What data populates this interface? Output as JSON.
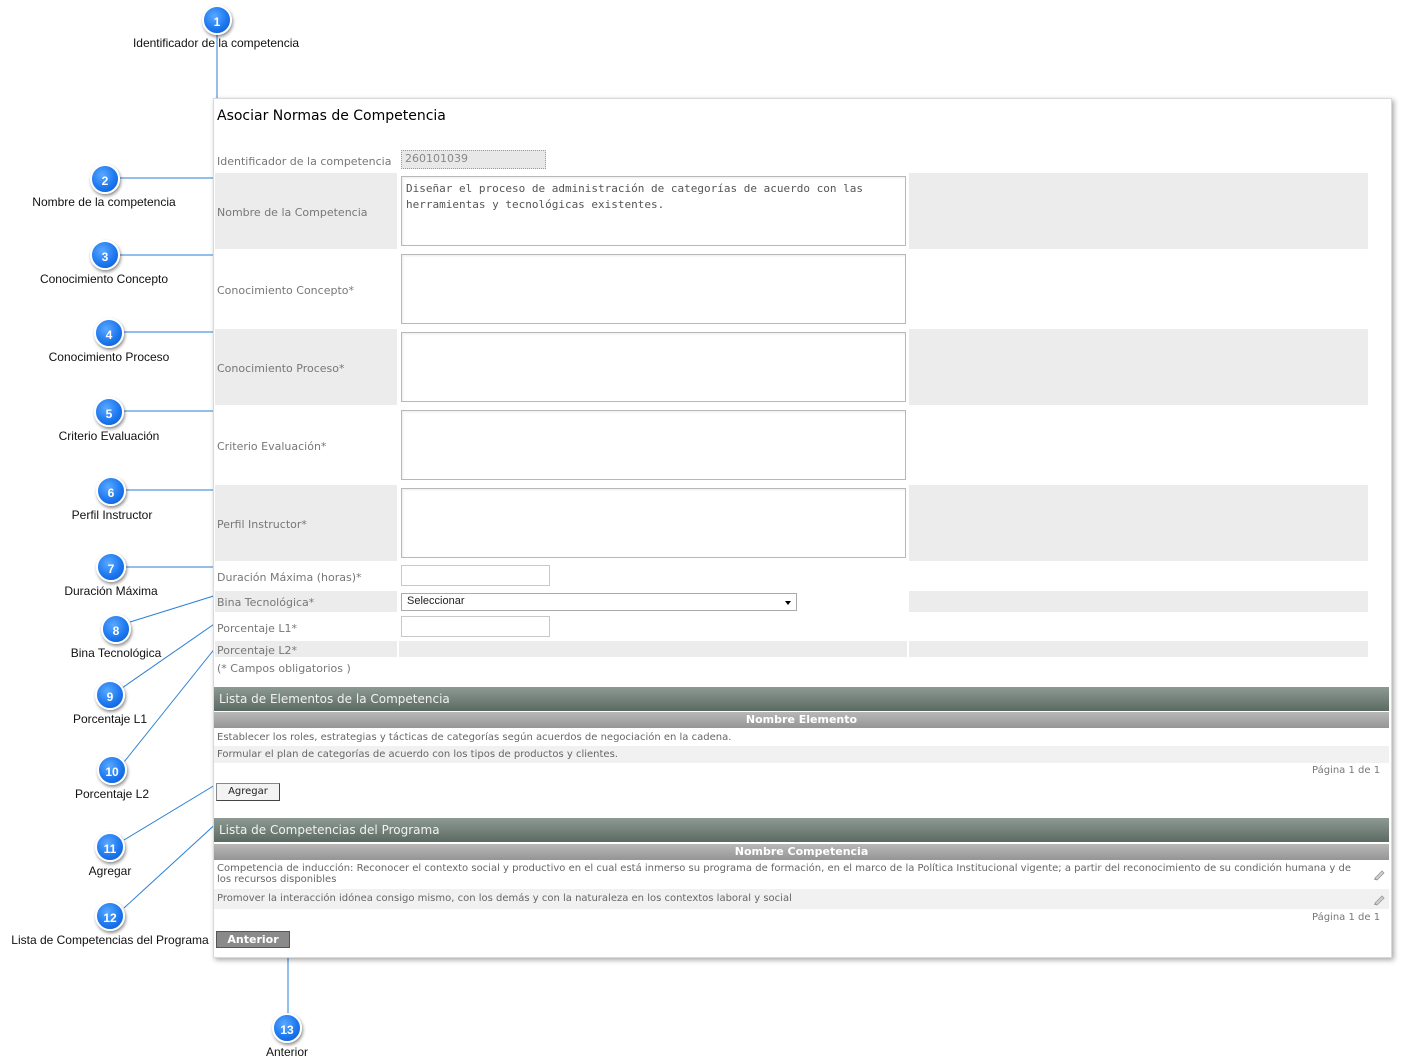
{
  "callouts": [
    {
      "num": "1",
      "label": "Identificador de la competencia"
    },
    {
      "num": "2",
      "label": "Nombre de la competencia"
    },
    {
      "num": "3",
      "label": "Conocimiento Concepto"
    },
    {
      "num": "4",
      "label": "Conocimiento Proceso"
    },
    {
      "num": "5",
      "label": "Criterio Evaluación"
    },
    {
      "num": "6",
      "label": "Perfil Instructor"
    },
    {
      "num": "7",
      "label": "Duración Máxima"
    },
    {
      "num": "8",
      "label": "Bina Tecnológica"
    },
    {
      "num": "9",
      "label": "Porcentaje L1"
    },
    {
      "num": "10",
      "label": "Porcentaje L2"
    },
    {
      "num": "11",
      "label": "Agregar"
    },
    {
      "num": "12",
      "label": "Lista de Competencias del Programa"
    },
    {
      "num": "13",
      "label": "Anterior"
    }
  ],
  "form": {
    "title": "Asociar Normas de Competencia",
    "id_label": "Identificador de la competencia",
    "id_value": "260101039",
    "nombre_label": "Nombre de la Competencia",
    "nombre_value": "Diseñar el proceso de administración de categorías de acuerdo con las herramientas y tecnológicas existentes.",
    "concepto_label": "Conocimiento Concepto*",
    "proceso_label": "Conocimiento Proceso*",
    "criterio_label": "Criterio Evaluación*",
    "perfil_label": "Perfil Instructor*",
    "duracion_label": "Duración Máxima (horas)*",
    "bina_label": "Bina Tecnológica*",
    "bina_selected": "Seleccionar",
    "l1_label": "Porcentaje L1*",
    "l2_label": "Porcentaje L2*",
    "required_note": "(* Campos obligatorios )"
  },
  "elementos": {
    "heading": "Lista de Elementos de la Competencia",
    "column": "Nombre Elemento",
    "rows": [
      "Establecer los roles, estrategias y tácticas de categorías según acuerdos de negociación en la cadena.",
      "Formular el plan de categorías de acuerdo con los tipos de productos y clientes."
    ],
    "pager": "Página 1 de 1",
    "add_button": "Agregar"
  },
  "competencias": {
    "heading": "Lista de Competencias del Programa",
    "column": "Nombre Competencia",
    "rows": [
      "Competencia de inducción: Reconocer el contexto social y productivo en el cual está inmerso su programa de formación, en el marco de la Política Institucional vigente; a partir del reconocimiento de su condición humana y de los recursos disponibles",
      "Promover la interacción idónea consigo mismo, con los demás y con la naturaleza en los contextos laboral y social"
    ],
    "row_icon": "pencil-icon",
    "pager": "Página 1 de 1",
    "back_button": "Anterior"
  },
  "colors": {
    "badge": "#1d78f0",
    "section_header": "#5b6a63",
    "row_alt": "#ececec"
  }
}
